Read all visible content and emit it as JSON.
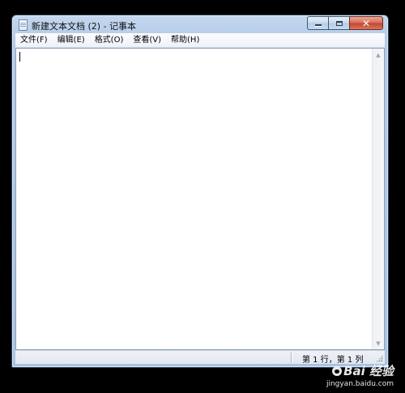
{
  "window": {
    "title": "新建文本文档 (2) - 记事本"
  },
  "caption_buttons": {
    "close_glyph": "✕"
  },
  "menu": {
    "items": [
      {
        "label": "文件(F)"
      },
      {
        "label": "编辑(E)"
      },
      {
        "label": "格式(O)"
      },
      {
        "label": "查看(V)"
      },
      {
        "label": "帮助(H)"
      }
    ]
  },
  "editor": {
    "content": ""
  },
  "status": {
    "position_text": "第 1 行，第 1 列"
  },
  "watermark": {
    "logo": "Bai 经验",
    "url": "jingyan.baidu.com"
  },
  "colors": {
    "frame": "#b3cbe8",
    "close_button": "#c4452c"
  }
}
